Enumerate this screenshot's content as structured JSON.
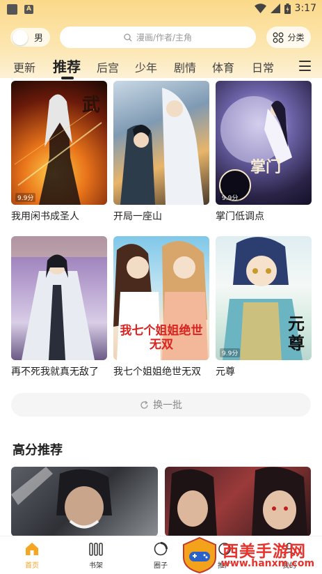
{
  "status_bar": {
    "time": "3:17"
  },
  "header": {
    "gender_label": "男",
    "search_placeholder": "漫画/作者/主角",
    "category_label": "分类"
  },
  "tabs": [
    {
      "label": "更新"
    },
    {
      "label": "推荐"
    },
    {
      "label": "后宫"
    },
    {
      "label": "少年"
    },
    {
      "label": "剧情"
    },
    {
      "label": "体育"
    },
    {
      "label": "日常"
    },
    {
      "label": " "
    }
  ],
  "recommend": {
    "items": [
      {
        "title": "我用闲书成圣人",
        "rating": "9.9分",
        "cover_text": "武"
      },
      {
        "title": "开局一座山",
        "rating": "",
        "cover_text": ""
      },
      {
        "title": "掌门低调点",
        "rating": "9.9分",
        "cover_text": "掌门"
      },
      {
        "title": "再不死我就真无敌了",
        "rating": "",
        "cover_text": ""
      },
      {
        "title": "我七个姐姐绝世无双",
        "rating": "",
        "cover_text": "我七个姐姐绝世无双"
      },
      {
        "title": "元尊",
        "rating": "9.9分",
        "cover_text": "元尊"
      }
    ],
    "refresh_label": "换一批"
  },
  "high_score": {
    "title": "高分推荐"
  },
  "bottom_nav": [
    {
      "label": "首页"
    },
    {
      "label": "书架"
    },
    {
      "label": "圈子"
    },
    {
      "label": "推广"
    },
    {
      "label": "我的"
    }
  ],
  "watermark": {
    "line1": "西美手游网",
    "line2": "www.hanxm.com"
  }
}
